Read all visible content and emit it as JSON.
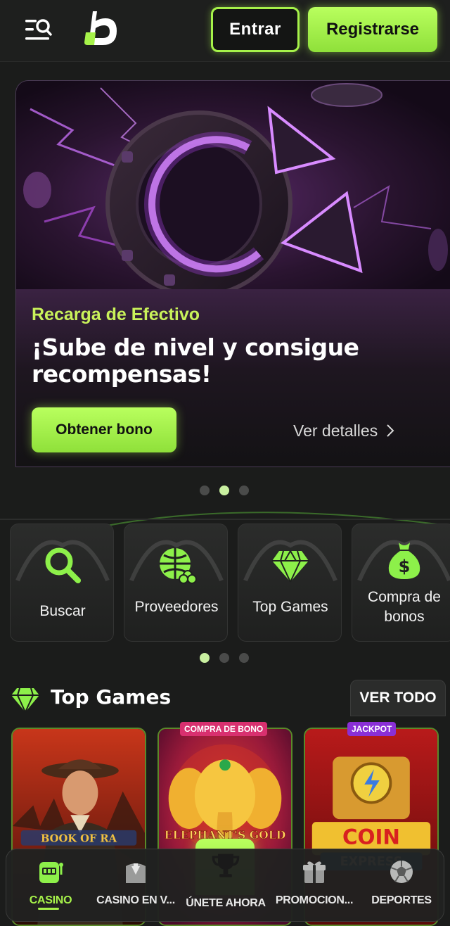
{
  "header": {
    "login_label": "Entrar",
    "register_label": "Registrarse"
  },
  "banner": {
    "kicker": "Recarga de Efectivo",
    "title": "¡Sube de nivel y consigue recompensas!",
    "cta_label": "Obtener bono",
    "details_label": "Ver detalles",
    "slide_count": 3,
    "active_slide": 2
  },
  "quick_links": {
    "items": [
      {
        "label": "Buscar",
        "icon": "search-icon"
      },
      {
        "label": "Proveedores",
        "icon": "globe-clover-icon"
      },
      {
        "label": "Top Games",
        "icon": "diamond-icon"
      },
      {
        "label": "Compra de bonos",
        "icon": "money-bag-icon"
      }
    ],
    "page_count": 3,
    "active_page": 1
  },
  "top_games": {
    "title": "Top Games",
    "view_all_label": "VER TODO",
    "games": [
      {
        "name": "Book of Ra",
        "badge": ""
      },
      {
        "name": "Elephant's Gold",
        "badge": "COMPRA DE BONO"
      },
      {
        "name": "Coin Express",
        "badge": "JACKPOT"
      }
    ]
  },
  "bottom_nav": {
    "items": [
      {
        "label": "CASINO",
        "icon": "slot-machine-icon",
        "active": true
      },
      {
        "label": "CASINO EN V...",
        "icon": "dealer-icon",
        "active": false
      },
      {
        "label": "ÚNETE AHORA",
        "icon": "trophy-icon",
        "active": false
      },
      {
        "label": "PROMOCION...",
        "icon": "gift-icon",
        "active": false
      },
      {
        "label": "DEPORTES",
        "icon": "soccer-ball-icon",
        "active": false
      }
    ]
  },
  "colors": {
    "accent": "#a6f24a",
    "background": "#1b1c1b",
    "banner_purple": "#9b3fd0",
    "compra_badge": "#d8306f",
    "jackpot_badge": "#8a2fd6"
  }
}
